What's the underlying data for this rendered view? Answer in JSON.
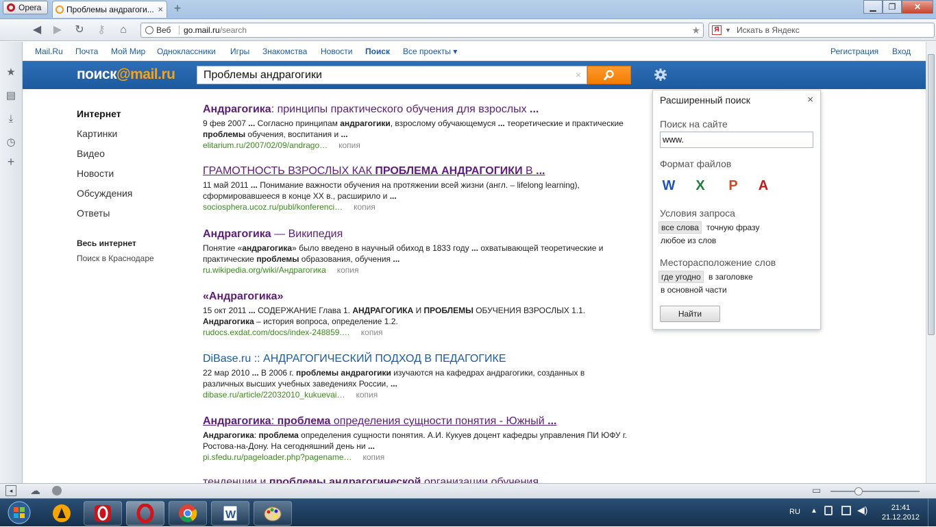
{
  "browser": {
    "menu_label": "Opera",
    "tab_title": "Проблемы андрагоги...",
    "tab_close": "×",
    "new_tab": "+",
    "address": {
      "mode_label": "Веб",
      "host": "go.mail.ru",
      "path": "/search"
    },
    "yandex_placeholder": "Искать в Яндекс",
    "yandex_badge": "Я"
  },
  "topnav": {
    "left": [
      "Mail.Ru",
      "Почта",
      "Мой Мир",
      "Одноклассники",
      "Игры",
      "Знакомства",
      "Новости",
      "Поиск",
      "Все проекты ▾"
    ],
    "right": [
      "Регистрация",
      "Вход"
    ]
  },
  "header": {
    "logo_prefix": "поиск",
    "logo_at": "@",
    "logo_suffix": "mail.ru",
    "query": "Проблемы андрагогики",
    "clear": "×"
  },
  "leftnav": {
    "items": [
      "Интернет",
      "Картинки",
      "Видео",
      "Новости",
      "Обсуждения",
      "Ответы"
    ],
    "region_title": "Весь интернет",
    "region_sub": "Поиск в Краснодаре"
  },
  "results": [
    {
      "title_html": "<b>Андрагогика</b>: принципы практического обучения для взрослых <b>...</b>",
      "snippet_html": "9 фев 2007 <b>...</b> Согласно принципам <b>андрагогики</b>, взрослому обучающемуся <b>...</b> теоретические и практические <b>проблемы</b> обучения, воспитания и <b>...</b>",
      "url": "elitarium.ru/2007/02/09/andrago…",
      "copy": "копия"
    },
    {
      "title_html": "ГРАМОТНОСТЬ ВЗРОСЛЫХ КАК <b>ПРОБЛЕМА АНДРАГОГИКИ</b> В <b>...</b>",
      "snippet_html": "11 май 2011 <b>...</b> Понимание важности обучения на протяжении всей жизни (англ. – lifelong learning), сформировавшееся в конце XX в., расширило и <b>...</b>",
      "url": "sociosphera.ucoz.ru/publ/konferenci…",
      "copy": "копия"
    },
    {
      "title_html": "<b>Андрагогика</b> — Википедия",
      "snippet_html": "Понятие «<b>андрагогика</b>» было введено в научный обиход в 1833 году <b>...</b> охватывающей теоретические и практические <b>проблемы</b> образования, обучения <b>...</b>",
      "url": "ru.wikipedia.org/wiki/Андрагогика",
      "copy": "копия"
    },
    {
      "title_html": "<b>«Андрагогика»</b>",
      "snippet_html": "15 окт 2011 <b>...</b> СОДЕРЖАНИЕ Глава 1. <b>АНДРАГОГИКА</b> И <b>ПРОБЛЕМЫ</b> ОБУЧЕНИЯ ВЗРОСЛЫХ 1.1. <b>Андрагогика</b> – история вопроса, определение 1.2.",
      "url": "rudocs.exdat.com/docs/index-248859.…",
      "copy": "копия"
    },
    {
      "title_html": "DiBase.ru :: АНДРАГОГИЧЕСКИЙ ПОДХОД В ПЕДАГОГИКЕ",
      "snippet_html": "22 мар 2010 <b>...</b> В 2006 г. <b>проблемы андрагогики</b> изучаются на кафедрах андрагогики, созданных в различных высших учебных заведениях России, <b>...</b>",
      "url": "dibase.ru/article/22032010_kukuevai…",
      "copy": "копия"
    },
    {
      "title_html": "<b>Андрагогика</b>: <b>проблема</b> определения сущности понятия - Южный <b>...</b>",
      "snippet_html": "<b>Андрагогика</b>: <b>проблема</b> определения сущности понятия. А.И. Кукуев доцент кафедры управления ПИ ЮФУ г. Ростова-на-Дону. На сегодняшний день ни <b>...</b>",
      "url": "pi.sfedu.ru/pageloader.php?pagename…",
      "copy": "копия"
    },
    {
      "title_html": "тенденции и <b>проблемы андрагогической</b> организации обучения",
      "snippet_html": "",
      "url": "",
      "copy": ""
    }
  ],
  "advanced": {
    "title": "Расширенный поиск",
    "close": "×",
    "site_label": "Поиск на сайте",
    "site_value": "www.",
    "formats_label": "Формат файлов",
    "formats": [
      "W",
      "X",
      "P",
      "A"
    ],
    "conditions_label": "Условия запроса",
    "conditions": [
      "все слова",
      "точную фразу",
      "любое из слов"
    ],
    "location_label": "Месторасположение слов",
    "locations": [
      "где угодно",
      "в заголовке",
      "в основной части"
    ],
    "find_button": "Найти"
  },
  "taskbar": {
    "lang": "RU",
    "time": "21:41",
    "date": "21.12.2012"
  },
  "colors": {
    "header_blue": "#1d5aa0",
    "search_orange": "#f27c00",
    "visited_link": "#5c1e79",
    "link": "#1a5ba6",
    "url_green": "#3c8a1d"
  }
}
